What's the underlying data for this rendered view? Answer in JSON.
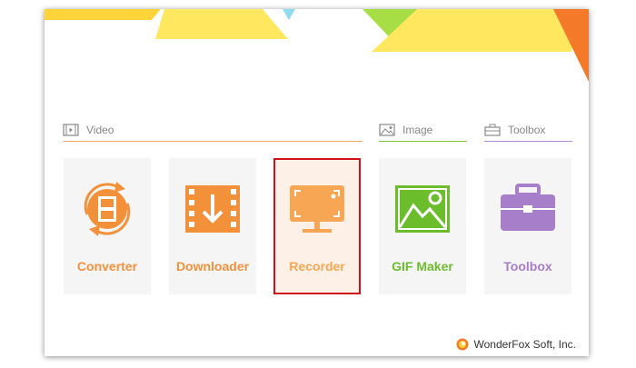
{
  "sections": {
    "video": {
      "label": "Video",
      "icon": "film-icon",
      "color": "#f3a865"
    },
    "image": {
      "label": "Image",
      "icon": "image-icon",
      "color": "#7ac43a"
    },
    "toolbox": {
      "label": "Toolbox",
      "icon": "toolbox-icon",
      "color": "#b48ad6"
    }
  },
  "tools": [
    {
      "label": "Converter",
      "icon": "convert-film-icon",
      "color": "#f3913b"
    },
    {
      "label": "Downloader",
      "icon": "download-film-icon",
      "color": "#f3913b"
    },
    {
      "label": "Recorder",
      "icon": "screen-record-icon",
      "color": "#f7a654",
      "selected": true
    },
    {
      "label": "GIF Maker",
      "icon": "picture-icon",
      "color": "#6cbd2c"
    },
    {
      "label": "Toolbox",
      "icon": "toolbox-icon",
      "color": "#a77ec9"
    }
  ],
  "footer": {
    "company": "WonderFox Soft, Inc.",
    "logo_icon": "wonderfox-logo-icon"
  },
  "colors": {
    "selection_border": "#d0121b",
    "tile_bg": "#f5f5f5"
  }
}
